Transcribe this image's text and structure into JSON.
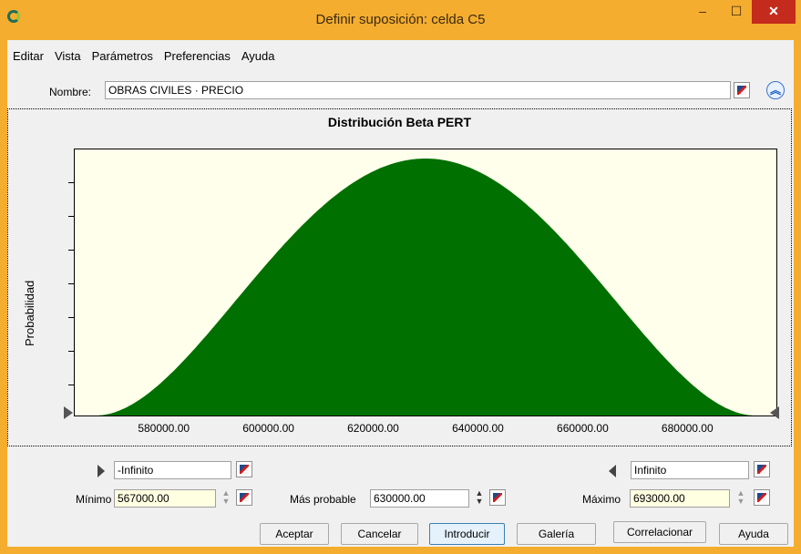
{
  "window": {
    "title": "Definir suposición: celda C5",
    "min_glyph": "–",
    "max_glyph": "☐",
    "close_glyph": "✕"
  },
  "menu": {
    "items": [
      "Editar",
      "Vista",
      "Parámetros",
      "Preferencias",
      "Ayuda"
    ]
  },
  "name": {
    "label": "Nombre:",
    "value": "OBRAS CIVILES · PRECIO"
  },
  "chart_data": {
    "type": "area",
    "title": "Distribución Beta PERT",
    "xlabel": "",
    "ylabel": "Probabilidad",
    "distribution": "Beta PERT",
    "min": 567000,
    "mode": 630000,
    "max": 693000,
    "xlim": [
      563000,
      697000
    ],
    "x_ticks": [
      "580000.00",
      "600000.00",
      "620000.00",
      "640000.00",
      "660000.00",
      "680000.00"
    ],
    "fill_color": "#007000",
    "background": "#ffffeb"
  },
  "bounds": {
    "lower": "-Infinito",
    "upper": "Infinito"
  },
  "params": {
    "min_label": "Mínimo",
    "min_value": "567000.00",
    "mode_label": "Más probable",
    "mode_value": "630000.00",
    "max_label": "Máximo",
    "max_value": "693000.00"
  },
  "buttons": {
    "accept": "Aceptar",
    "cancel": "Cancelar",
    "enter": "Introducir",
    "gallery": "Galería",
    "correlate": "Correlacionar",
    "help": "Ayuda"
  }
}
